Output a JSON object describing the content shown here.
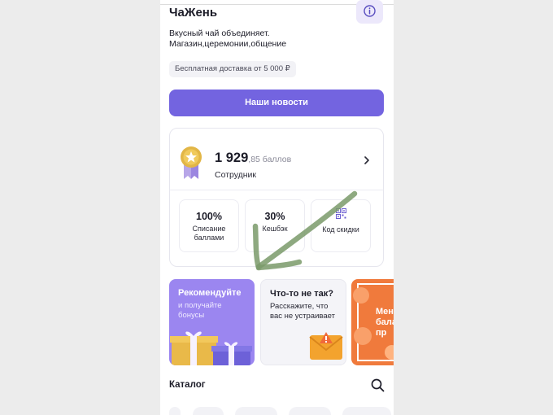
{
  "shop": {
    "title": "ЧаЖень",
    "description_line1": "Вкусный чай объединяет.",
    "description_line2": "Магазин,церемонии,общение",
    "delivery_badge": "Бесплатная доставка от 5 000 ₽"
  },
  "news_button": {
    "label": "Наши новости"
  },
  "loyalty": {
    "points_whole": "1 929",
    "points_fraction": ",85 баллов",
    "role": "Сотрудник",
    "stats": [
      {
        "value": "100%",
        "label_line1": "Списание",
        "label_line2": "баллами"
      },
      {
        "value": "30%",
        "label_line1": "Кешбэк",
        "label_line2": ""
      },
      {
        "value": "",
        "label_line1": "Код скидки",
        "label_line2": ""
      }
    ]
  },
  "promos": [
    {
      "title": "Рекомендуйте",
      "subtitle_line1": "и получайте",
      "subtitle_line2": "бонусы"
    },
    {
      "title": "Что-то не так?",
      "subtitle_line1": "Расскажите, что",
      "subtitle_line2": "вас не устраивает"
    },
    {
      "title_line1": "Мен",
      "title_line2": "бала",
      "title_line3": "пр"
    }
  ],
  "catalog": {
    "title": "Каталог"
  },
  "icons": {
    "info": "info-icon",
    "medal": "medal-icon",
    "chevron": "chevron-right-icon",
    "qr": "qr-code-icon",
    "search": "search-icon",
    "annotation": "arrow-annotation"
  },
  "colors": {
    "accent": "#7364e0",
    "promo_purple": "#9b86f0",
    "promo_orange": "#f07a3c",
    "annotation_green": "#7a9a6a"
  }
}
